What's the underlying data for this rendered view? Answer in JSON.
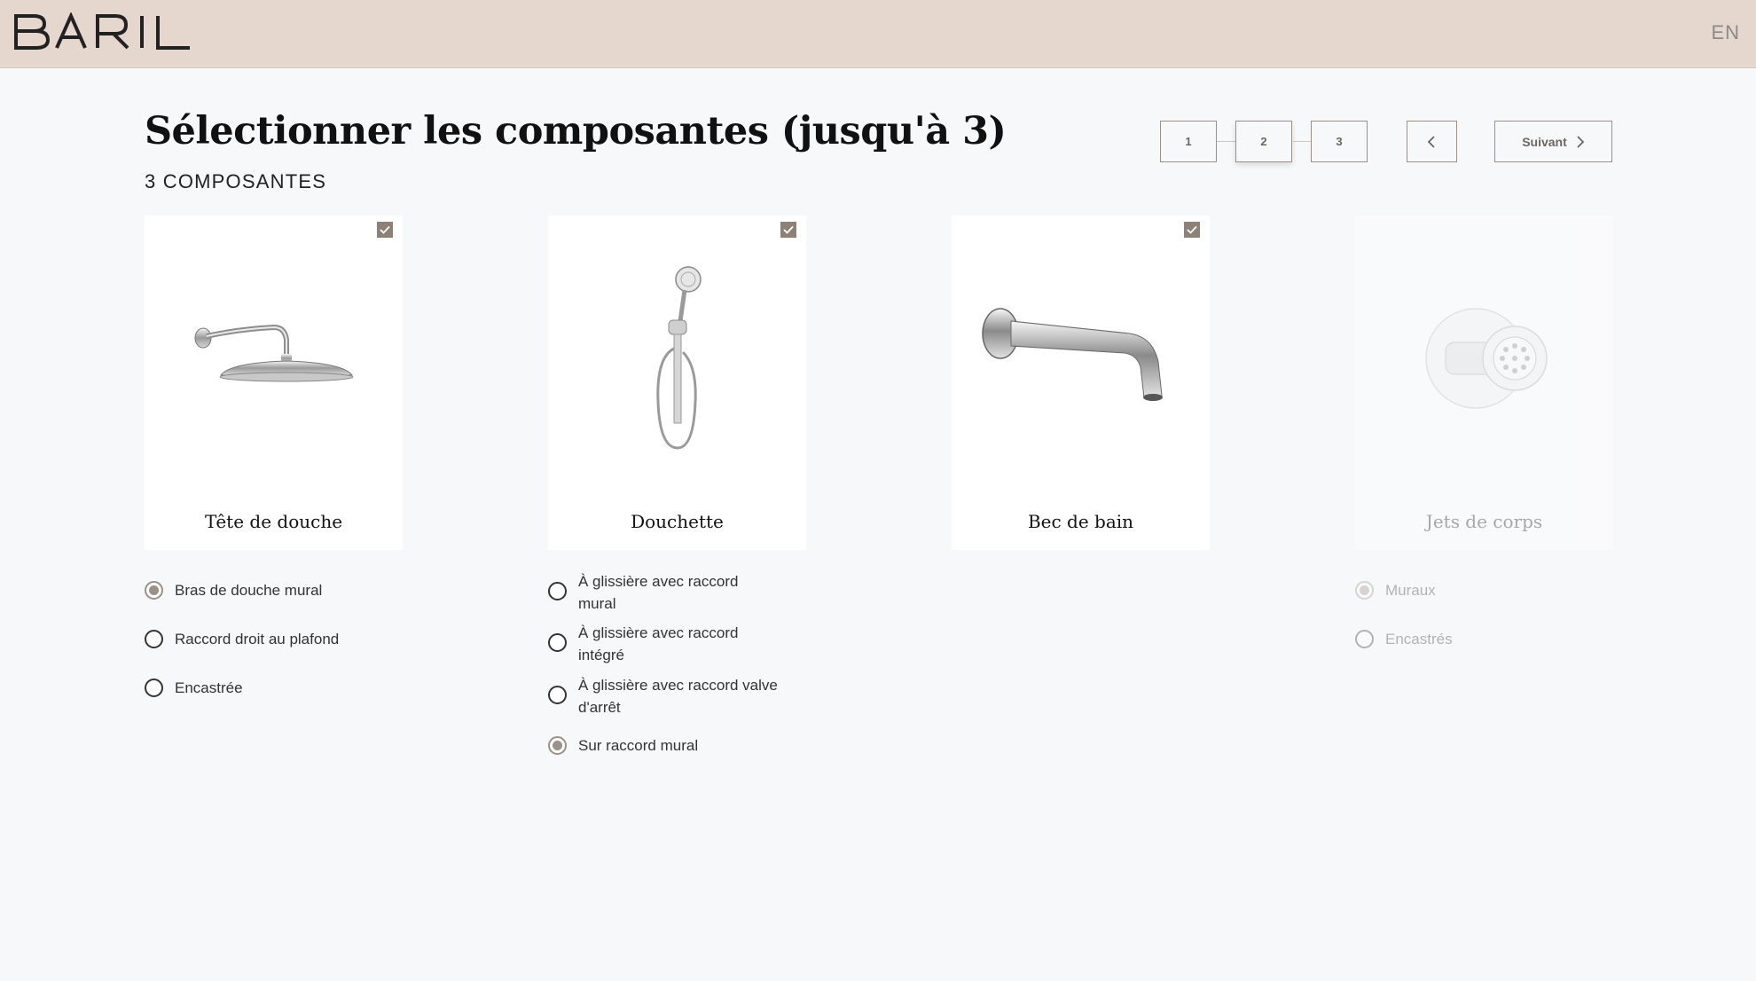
{
  "header": {
    "brand": "BARIL",
    "language": "EN"
  },
  "page": {
    "title": "Sélectionner les composantes (jusqu'à 3)",
    "subtitle": "3 COMPOSANTES"
  },
  "stepper": {
    "steps": [
      "1",
      "2",
      "3"
    ],
    "current_step": "2",
    "next_label": "Suivant"
  },
  "components": [
    {
      "name": "Tête de douche",
      "selected": true,
      "icon": "shower-head-icon",
      "options": [
        {
          "label": "Bras de douche mural",
          "selected": true
        },
        {
          "label": "Raccord droit au plafond",
          "selected": false
        },
        {
          "label": "Encastrée",
          "selected": false
        }
      ]
    },
    {
      "name": "Douchette",
      "selected": true,
      "icon": "hand-shower-icon",
      "options": [
        {
          "label": "À glissière avec raccord mural",
          "selected": false
        },
        {
          "label": "À glissière avec raccord intégré",
          "selected": false
        },
        {
          "label": "À glissière avec raccord valve d'arrêt",
          "selected": false
        },
        {
          "label": "Sur raccord mural",
          "selected": true
        }
      ]
    },
    {
      "name": "Bec de bain",
      "selected": true,
      "icon": "tub-spout-icon",
      "options": []
    },
    {
      "name": "Jets de corps",
      "selected": false,
      "disabled": true,
      "icon": "body-jet-icon",
      "options": [
        {
          "label": "Muraux",
          "selected": true
        },
        {
          "label": "Encastrés",
          "selected": false
        }
      ]
    }
  ],
  "colors": {
    "topbar": "#e5d7ce",
    "background": "#f7f8fa",
    "accent": "#8d8177"
  }
}
